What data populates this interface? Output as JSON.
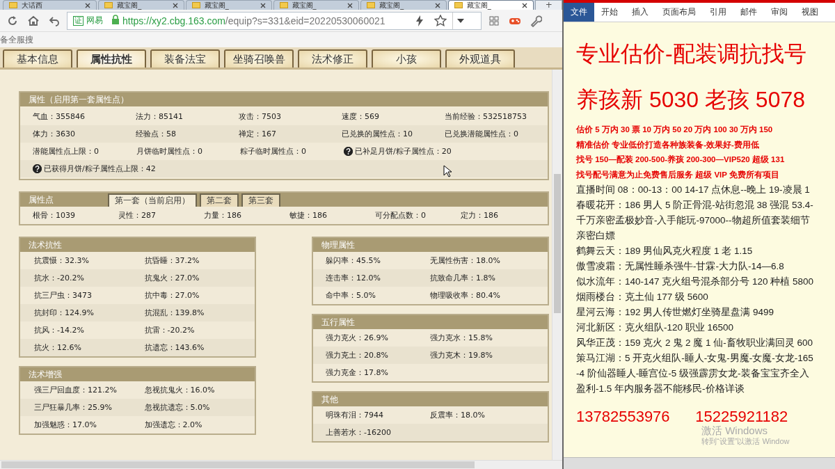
{
  "browser": {
    "tabs": [
      {
        "label": "大话西",
        "selected": false
      },
      {
        "label": "藏宝阁_",
        "selected": false
      },
      {
        "label": "藏宝阁_",
        "selected": false
      },
      {
        "label": "藏宝阁_",
        "selected": false
      },
      {
        "label": "藏宝阁_",
        "selected": false
      },
      {
        "label": "藏宝阁_",
        "selected": true
      }
    ],
    "new_tab": "+",
    "site_badge_icon": "证",
    "site_badge": "网易",
    "url_host": "https://xy2.cbg.163.com",
    "url_path": "/equip?s=331&eid=20220530060021",
    "bookmark": "备全服搜"
  },
  "page_tabs": [
    {
      "label": "基本信息",
      "selected": false
    },
    {
      "label": "属性抗性",
      "selected": true
    },
    {
      "label": "装备法宝",
      "selected": false
    },
    {
      "label": "坐骑召唤兽",
      "selected": false
    },
    {
      "label": "法术修正",
      "selected": false
    },
    {
      "label": "小孩",
      "selected": false
    },
    {
      "label": "外观道具",
      "selected": false
    }
  ],
  "attributes": {
    "title": "属性（启用第一套属性点）",
    "rows": [
      [
        {
          "kind": "value",
          "text": "气血：355846"
        },
        {
          "kind": "value",
          "text": "法力：85141"
        },
        {
          "kind": "value",
          "text": "攻击：7503"
        },
        {
          "kind": "value",
          "text": "速度：569"
        },
        {
          "kind": "value",
          "text": "当前经验：532518753"
        }
      ],
      [
        {
          "kind": "value",
          "text": "体力：3630"
        },
        {
          "kind": "value",
          "text": "经验点：58"
        },
        {
          "kind": "value",
          "text": "禅定：167"
        },
        {
          "kind": "value",
          "text": "已兑换的属性点：10"
        },
        {
          "kind": "value",
          "text": "已兑换潜能属性点：0"
        }
      ],
      [
        {
          "kind": "value",
          "text": "潜能属性点上限：0"
        },
        {
          "kind": "value",
          "text": "月饼临时属性点：0"
        },
        {
          "kind": "value",
          "text": "粽子临时属性点：0"
        },
        {
          "kind": "help",
          "text": "已补足月饼/粽子属性点：20"
        }
      ],
      [
        {
          "kind": "help",
          "text": "已获得月饼/粽子属性点上限：42"
        }
      ]
    ]
  },
  "attribute_points": {
    "title": "属性点",
    "tabs": [
      {
        "label": "第一套（当前启用）",
        "selected": true
      },
      {
        "label": "第二套",
        "selected": false
      },
      {
        "label": "第三套",
        "selected": false
      }
    ],
    "items": [
      "根骨：1039",
      "灵性：287",
      "力量：186",
      "敏捷：186",
      "可分配点数：0",
      "定力：186"
    ]
  },
  "left_panels": [
    {
      "title": "法术抗性",
      "items": [
        "抗震慑：32.3%",
        "抗昏睡：37.2%",
        "抗水：-20.2%",
        "抗鬼火：27.0%",
        "抗三尸虫：3473",
        "抗中毒：27.0%",
        "抗封印：124.9%",
        "抗混乱：139.8%",
        "抗风：-14.2%",
        "抗雷：-20.2%",
        "抗火：12.6%",
        "抗遗忘：143.6%"
      ]
    },
    {
      "title": "法术增强",
      "items": [
        "强三尸回血度：121.2%",
        "忽视抗鬼火：16.0%",
        "三尸狂暴几率：25.9%",
        "忽视抗遗忘：5.0%",
        "加强魅惑：17.0%",
        "加强遗忘：2.0%"
      ]
    }
  ],
  "right_panels": [
    {
      "title": "物理属性",
      "items": [
        "躲闪率：45.5%",
        "无属性伤害：18.0%",
        "连击率：12.0%",
        "抗致命几率：1.8%",
        "命中率：5.0%",
        "物理吸收率：80.4%"
      ]
    },
    {
      "title": "五行属性",
      "items": [
        "强力克火：26.9%",
        "强力克水：15.8%",
        "强力克土：20.8%",
        "强力克木：19.8%",
        "强力克金：17.8%"
      ]
    },
    {
      "title": "其他",
      "items": [
        "明珠有泪：7944",
        "反震率：18.0%",
        "上善若水：-16200"
      ]
    }
  ],
  "document": {
    "ribbon_tabs": [
      {
        "label": "文件",
        "selected": true
      },
      {
        "label": "开始",
        "selected": false
      },
      {
        "label": "插入",
        "selected": false
      },
      {
        "label": "页面布局",
        "selected": false
      },
      {
        "label": "引用",
        "selected": false
      },
      {
        "label": "邮件",
        "selected": false
      },
      {
        "label": "审阅",
        "selected": false
      },
      {
        "label": "视图",
        "selected": false
      }
    ],
    "lines": [
      {
        "kind": "heading",
        "text": "专业估价-配装调抗找号"
      },
      {
        "kind": "heading",
        "text": "养孩新 5030 老孩 5078"
      },
      {
        "kind": "notice",
        "text": "估价 5 万内 30 票   10 万内 50  20 万内 100  30 万内 150"
      },
      {
        "kind": "notice",
        "text": "精准估价   专业低价打造各种族装备-效果好-费用低"
      },
      {
        "kind": "notice",
        "text": "找号 150—配装 200-500-养孩 200-300—VIP520 超级 131"
      },
      {
        "kind": "notice",
        "text": "找号配号满意为止免费售后服务   超级 VIP 免费所有项目"
      },
      {
        "kind": "body",
        "text": "直播时间 08：00-13：00  14-17 点休息--晚上 19-凌晨 1"
      },
      {
        "kind": "body",
        "text": "春暖花开：186 男人 5 阶正骨混-站街忽混 38 强混 53.4-"
      },
      {
        "kind": "body",
        "text": "千万亲密孟极妙音-入手能玩-97000--物超所值套装细节"
      },
      {
        "kind": "body",
        "text": "亲密白嫖"
      },
      {
        "kind": "body",
        "text": "鹤舞云天：189 男仙风克火程度 1 老 1.15"
      },
      {
        "kind": "body",
        "text": "傲雪凌霜：无属性睡杀强牛-甘霖-大力队-14—6.8"
      },
      {
        "kind": "body",
        "text": "似水流年：140-147 克火组号混杀部分号 120 种植 5800"
      },
      {
        "kind": "body",
        "text": "烟雨楼台：克土仙 177 级 5600"
      },
      {
        "kind": "body",
        "text": "星河云海：192 男人传世燃灯坐骑星盘满 9499"
      },
      {
        "kind": "body",
        "text": "河北新区：克火组队-120 职业 16500"
      },
      {
        "kind": "body",
        "text": "风华正茂：159 克火 2 鬼 2 魔 1 仙-畜牧职业满回灵 600"
      },
      {
        "kind": "body",
        "text": "策马江湖：5 开克火组队-睡人-女鬼-男魔-女魔-女龙-165"
      },
      {
        "kind": "body",
        "text": "-4 阶仙器睡人-睡宫位-5 级强霹雳女龙-装备宝宝齐全入"
      },
      {
        "kind": "body",
        "text": "盈利-1.5 年内服务器不能移民-价格详谈"
      },
      {
        "kind": "phones",
        "text": "13782553976      15225921182"
      }
    ],
    "activation": [
      "激活 Windows",
      "转到“设置”以激活 Window"
    ]
  }
}
